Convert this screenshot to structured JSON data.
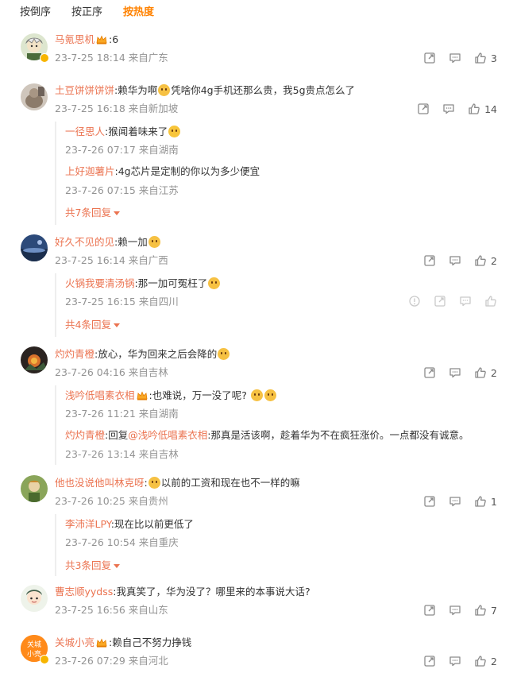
{
  "sort_tabs": [
    {
      "label": "按倒序",
      "active": false
    },
    {
      "label": "按正序",
      "active": false
    },
    {
      "label": "按热度",
      "active": true
    }
  ],
  "comments": [
    {
      "user": "马氪思机",
      "text": ":6",
      "time": "23-7-25 18:14",
      "location": "来自广东",
      "likes": "3"
    },
    {
      "user": "土豆饼饼饼饼",
      "text_a": ":赖华为啊",
      "text_b": "凭啥你4g手机还那么贵，我5g贵点怎么了",
      "time": "23-7-25 16:18",
      "location": "来自新加坡",
      "likes": "14",
      "replies": [
        {
          "user": "一径思人",
          "text": ":猴闻着味来了",
          "time": "23-7-26 07:17",
          "location": "来自湖南"
        },
        {
          "user": "上好迦薯片",
          "text": ":4g芯片是定制的你以为多少便宜",
          "time": "23-7-26 07:15",
          "location": "来自江苏"
        }
      ],
      "more": "共7条回复"
    },
    {
      "user": "好久不见的见",
      "text": ":赖一加",
      "time": "23-7-25 16:14",
      "location": "来自广西",
      "likes": "2",
      "replies": [
        {
          "user": "火锅我要清汤锅",
          "text": ":那一加可冤枉了",
          "time": "23-7-25 16:15",
          "location": "来自四川"
        }
      ],
      "more": "共4条回复"
    },
    {
      "user": "灼灼青橙",
      "text": ":放心，华为回来之后会降的",
      "time": "23-7-26 04:16",
      "location": "来自吉林",
      "likes": "2",
      "replies": [
        {
          "user": "浅吟低唱素衣相",
          "text": ":也难说，万一没了呢?",
          "time": "23-7-26 11:21",
          "location": "来自湖南"
        },
        {
          "user": "灼灼青橙",
          "text_pre": ":回复",
          "mention": "@浅吟低唱素衣相",
          "text": ":那真是活该啊，趁着华为不在疯狂涨价。一点都没有诚意。",
          "time": "23-7-26 13:14",
          "location": "来自吉林"
        }
      ]
    },
    {
      "user": "他也没说他叫林克呀",
      "text": "以前的工资和现在也不一样的嘛",
      "text_prefix": ":",
      "time": "23-7-26 10:25",
      "location": "来自贵州",
      "likes": "1",
      "replies": [
        {
          "user": "李沛洋LPY",
          "text": ":现在比以前更低了",
          "time": "23-7-26 10:54",
          "location": "来自重庆"
        }
      ],
      "more": "共3条回复"
    },
    {
      "user": "曹志顺yydss",
      "text": ":我真笑了，华为没了？哪里来的本事说大话?",
      "time": "23-7-25 16:56",
      "location": "来自山东",
      "likes": "7"
    },
    {
      "user": "关城小亮",
      "text": ":赖自己不努力挣钱",
      "time": "23-7-26 07:29",
      "location": "来自河北",
      "likes": "2",
      "avatar_text": "关城小亮"
    }
  ],
  "colors": {
    "accent": "#ff8200",
    "username": "#eb7350",
    "meta": "#939393"
  },
  "icons": [
    "share-icon",
    "comment-icon",
    "like-icon",
    "report-icon",
    "crown-icon",
    "emoji-icon"
  ]
}
